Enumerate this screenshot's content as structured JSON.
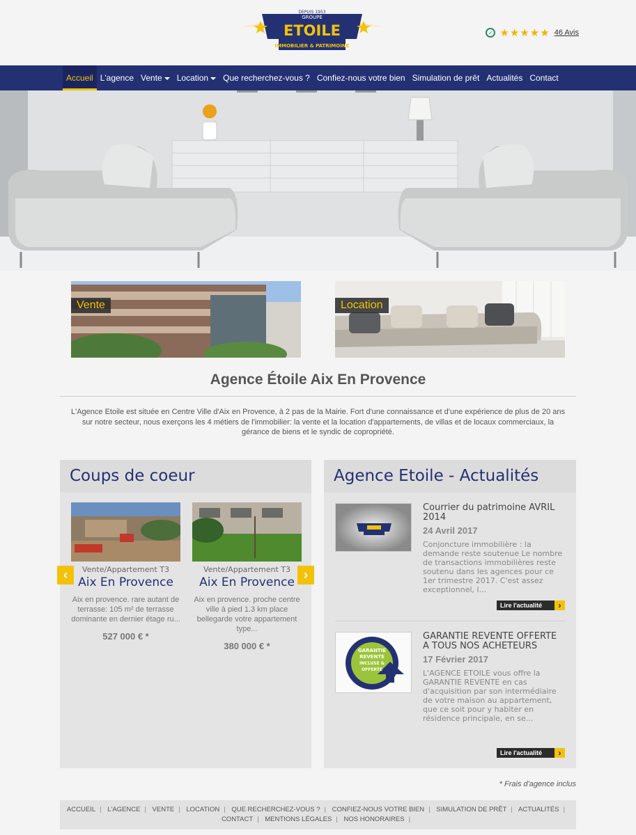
{
  "header": {
    "logo": {
      "line1": "DEPUIS 1953",
      "line2": "GROUPE",
      "brand": "ETOILE",
      "tagline": "IMMOBILIER & PATRIMOINE"
    },
    "rating": {
      "value": 4.7,
      "max": 5,
      "reviews_label": "46 Avis"
    }
  },
  "nav": {
    "items": [
      {
        "label": "Accueil",
        "active": true,
        "dropdown": false
      },
      {
        "label": "L'agence",
        "active": false,
        "dropdown": false
      },
      {
        "label": "Vente",
        "active": false,
        "dropdown": true
      },
      {
        "label": "Location",
        "active": false,
        "dropdown": true
      },
      {
        "label": "Que recherchez-vous ?",
        "active": false,
        "dropdown": false
      },
      {
        "label": "Confiez-nous votre bien",
        "active": false,
        "dropdown": false
      },
      {
        "label": "Simulation de prêt",
        "active": false,
        "dropdown": false
      },
      {
        "label": "Actualités",
        "active": false,
        "dropdown": false
      },
      {
        "label": "Contact",
        "active": false,
        "dropdown": false
      }
    ]
  },
  "tiles": {
    "vente": "Vente",
    "location": "Location"
  },
  "main": {
    "title": "Agence Étoile Aix En Provence",
    "intro": "L'Agence Etoile est située en Centre Ville d'Aix en Provence, à 2 pas de la Mairie. Fort d'une connaissance et d'une expérience de plus de 20 ans sur notre secteur, nous exerçons les 4 métiers de l'immobilier: la vente et la location d'appartements, de villas et de locaux commerciaux, la gérance de biens et le syndic de copropriété."
  },
  "coups": {
    "heading": "Coups de coeur",
    "items": [
      {
        "type": "Vente/Appartement T3",
        "city": "Aix En Provence",
        "desc": "Aix en provence. rare autant de terrasse: 105 m² de terrasse dominante en dernier étage ru...",
        "price": "527 000 € *"
      },
      {
        "type": "Vente/Appartement T3",
        "city": "Aix En Provence",
        "desc": "Aix en provence. proche centre ville à pied 1.3 km place bellegarde votre appartement type...",
        "price": "380 000 € *"
      }
    ]
  },
  "news": {
    "heading": "Agence Etoile - Actualités",
    "items": [
      {
        "title": "Courrier du patrimoine AVRIL 2014",
        "date": "24 Avril 2017",
        "body": "Conjoncture immobilière : la demande reste soutenue Le nombre de transactions immobilières reste soutenu dans les agences pour ce 1er trimestre 2017. C'est assez exceptionnel, l...",
        "button": "Lire l'actualité"
      },
      {
        "title": "GARANTIE REVENTE OFFERTE A TOUS NOS ACHETEURS",
        "date": "17 Février 2017",
        "body": "L'AGENCE ETOILE vous offre la GARANTIE REVENTE en cas d'acquisition par son intermédiaire de votre maison au appartement, que ce soit pour y habiter en résidence principale, en se...",
        "button": "Lire l'actualité",
        "badge": "GARANTIE REVENTE INCLUSE & OFFERTE"
      }
    ]
  },
  "frais": "* Frais d'agence inclus",
  "footer": {
    "links": [
      "ACCUEIL",
      "L'AGENCE",
      "VENTE",
      "LOCATION",
      "QUE RECHERCHEZ-VOUS ?",
      "CONFIEZ-NOUS VOTRE BIEN",
      "SIMULATION DE PRÊT",
      "ACTUALITÉS",
      "CONTACT",
      "MENTIONS LÉGALES",
      "NOS HONORAIRES"
    ]
  },
  "colors": {
    "brand_blue": "#233173",
    "accent_yellow": "#f2c20a"
  }
}
